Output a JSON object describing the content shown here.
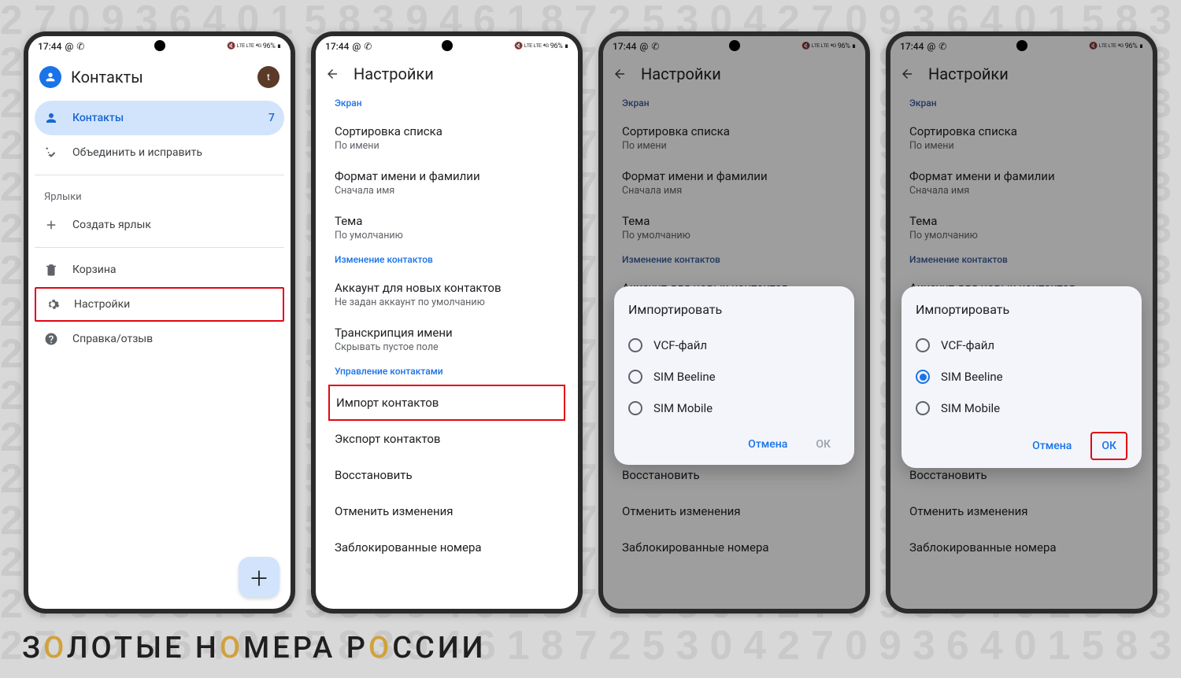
{
  "status": {
    "time": "17:44",
    "battery": "96%"
  },
  "screen1": {
    "title": "Контакты",
    "account_initial": "t",
    "nav": {
      "contacts": "Контакты",
      "contacts_count": "7",
      "merge": "Объединить и исправить",
      "labels_section": "Ярлыки",
      "create_label": "Создать ярлык",
      "trash": "Корзина",
      "settings": "Настройки",
      "help": "Справка/отзыв"
    }
  },
  "settings": {
    "title": "Настройки",
    "sections": {
      "screen": "Экран",
      "edit_contacts": "Изменение контактов",
      "manage_contacts": "Управление контактами"
    },
    "rows": {
      "sort": {
        "t": "Сортировка списка",
        "s": "По имени"
      },
      "name_format": {
        "t": "Формат имени и фамилии",
        "s": "Сначала имя"
      },
      "theme": {
        "t": "Тема",
        "s": "По умолчанию"
      },
      "default_account": {
        "t": "Аккаунт для новых контактов",
        "s": "Не задан аккаунт по умолчанию"
      },
      "phonetic": {
        "t": "Транскрипция имени",
        "s": "Скрывать пустое поле"
      },
      "import": "Импорт контактов",
      "export": "Экспорт контактов",
      "restore": "Восстановить",
      "undo": "Отменить изменения",
      "blocked": "Заблокированные номера"
    }
  },
  "dialog": {
    "title": "Импортировать",
    "options": {
      "vcf": "VCF-файл",
      "sim1": "SIM Beeline",
      "sim2": "SIM Mobile"
    },
    "cancel": "Отмена",
    "ok": "ОК"
  },
  "watermark": {
    "p1": "З",
    "p2": "О",
    "p3": "ЛОТЫЕ Н",
    "p4": "О",
    "p5": "МЕРА Р",
    "p6": "О",
    "p7": "ССИИ"
  }
}
